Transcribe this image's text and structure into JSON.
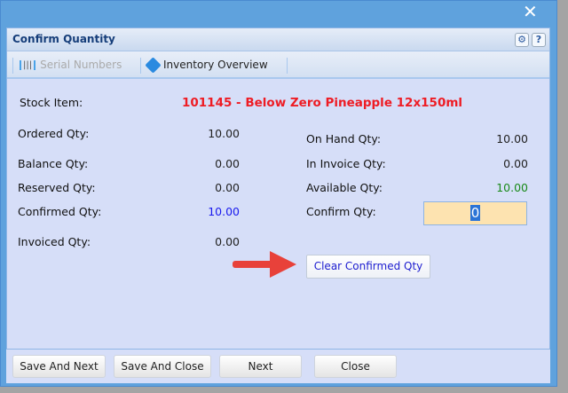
{
  "dialog": {
    "title": "Confirm Quantity",
    "close_icon": "✕",
    "settings_icon": "⚙",
    "help_label": "?"
  },
  "toolbar": {
    "serial_numbers": "Serial Numbers",
    "inventory_overview": "Inventory Overview"
  },
  "stock": {
    "label": "Stock Item:",
    "value": "101145 - Below Zero Pineapple 12x150ml"
  },
  "left": [
    {
      "label": "Ordered Qty:",
      "value": "10.00"
    },
    {
      "label": "Balance Qty:",
      "value": "0.00"
    },
    {
      "label": "Reserved Qty:",
      "value": "0.00"
    },
    {
      "label": "Confirmed Qty:",
      "value": "10.00"
    },
    {
      "label": "Invoiced Qty:",
      "value": "0.00"
    }
  ],
  "right": [
    {
      "label": "On Hand Qty:",
      "value": "10.00"
    },
    {
      "label": "In Invoice Qty:",
      "value": "0.00"
    },
    {
      "label": "Available Qty:",
      "value": "10.00"
    }
  ],
  "confirm": {
    "label": "Confirm Qty:",
    "value": "0"
  },
  "clear_button": "Clear Confirmed Qty",
  "footer": {
    "save_next": "Save And Next",
    "save_close": "Save And Close",
    "next": "Next",
    "close": "Close"
  },
  "colors": {
    "stock": "#ee1c24",
    "confirmed": "#1a1aee",
    "available": "#1a8a1a"
  }
}
